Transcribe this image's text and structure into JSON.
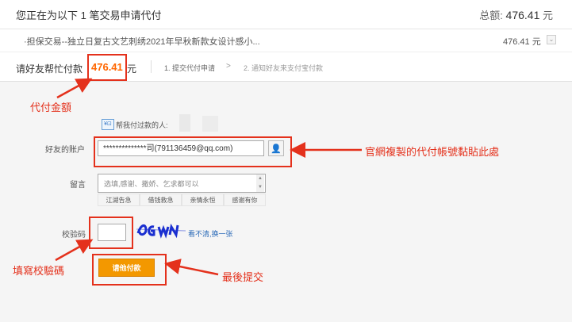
{
  "header": {
    "title": "您正在为以下 1 笔交易申请代付",
    "total_label": "总额:",
    "total_value": "476.41",
    "total_unit": "元"
  },
  "item": {
    "description": "·担保交易--独立日复古文艺刺绣2021年早秋新款女设计感小...",
    "amount": "476.41",
    "unit": "元",
    "toggle": "⌄"
  },
  "steps": {
    "label": "请好友帮忙付款",
    "amount": "476.41",
    "unit": "元",
    "step1": "1. 提交代付申请",
    "arrow": ">",
    "step2": "2. 通知好友来支付宝付款"
  },
  "form": {
    "payer_icon": "¥⊡",
    "payer_label": "帮我付过款的人:",
    "friend_label": "好友的账户",
    "friend_value": "**************司(791136459@qq.com)",
    "contact_icon": "👤",
    "message_label": "留言",
    "message_placeholder": "选填,感谢、撒娇、乞求都可以",
    "phrases": [
      "江湖告急",
      "借钱救急",
      "亲情永恒",
      "感谢有你"
    ],
    "code_label": "校验码",
    "code_value": "",
    "captcha_text": "9G W",
    "refresh_text": "看不清,换一张",
    "submit_label": "请他付款"
  },
  "annotations": {
    "amount_note": "代付金額",
    "account_note": "官網複製的代付帳號黏貼此處",
    "code_note": "填寫校驗碼",
    "submit_note": "最後提交"
  },
  "colors": {
    "accent": "#f60",
    "annotation_red": "#e4311c",
    "button_orange": "#f39800"
  }
}
